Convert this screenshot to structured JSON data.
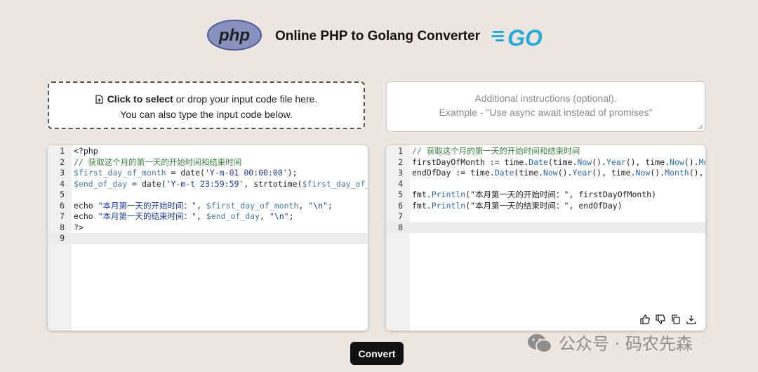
{
  "header": {
    "title": "Online PHP to Golang Converter",
    "php_logo_text": "php",
    "go_logo_text": "GO"
  },
  "dropzone": {
    "bold": "Click to select",
    "rest": " or drop your input code file here.",
    "line2": "You can also type the input code below."
  },
  "instructions": {
    "line1": "Additional instructions (optional).",
    "line2": "Example - \"Use async await instead of promises\""
  },
  "php_editor": {
    "lines": [
      [
        {
          "t": "<?php",
          "c": "plain"
        }
      ],
      [
        {
          "t": "// 获取这个月的第一天的开始时间和结束时间",
          "c": "comment"
        }
      ],
      [
        {
          "t": "$first_day_of_month",
          "c": "var"
        },
        {
          "t": " = ",
          "c": "plain"
        },
        {
          "t": "date(",
          "c": "plain"
        },
        {
          "t": "'Y-m-01 00:00:00'",
          "c": "str"
        },
        {
          "t": ");",
          "c": "plain"
        }
      ],
      [
        {
          "t": "$end_of_day",
          "c": "var"
        },
        {
          "t": " = date(",
          "c": "plain"
        },
        {
          "t": "'Y-m-t 23:59:59'",
          "c": "str"
        },
        {
          "t": ", strtotime(",
          "c": "plain"
        },
        {
          "t": "$first_day_of_month",
          "c": "var"
        },
        {
          "t": "));",
          "c": "plain"
        }
      ],
      [
        {
          "t": "",
          "c": "plain"
        }
      ],
      [
        {
          "t": "echo ",
          "c": "plain"
        },
        {
          "t": "\"本月第一天的开始时间：\"",
          "c": "str"
        },
        {
          "t": ", ",
          "c": "plain"
        },
        {
          "t": "$first_day_of_month",
          "c": "var"
        },
        {
          "t": ", ",
          "c": "plain"
        },
        {
          "t": "\"\\n\"",
          "c": "str"
        },
        {
          "t": ";",
          "c": "plain"
        }
      ],
      [
        {
          "t": "echo ",
          "c": "plain"
        },
        {
          "t": "\"本月第一天的结束时间：\"",
          "c": "str"
        },
        {
          "t": ", ",
          "c": "plain"
        },
        {
          "t": "$end_of_day",
          "c": "var"
        },
        {
          "t": ", ",
          "c": "plain"
        },
        {
          "t": "\"\\n\"",
          "c": "str"
        },
        {
          "t": ";",
          "c": "plain"
        }
      ],
      [
        {
          "t": "?>",
          "c": "plain"
        }
      ],
      [
        {
          "t": "",
          "c": "plain"
        }
      ]
    ],
    "active_line": 9
  },
  "go_editor": {
    "lines": [
      [
        {
          "t": "// 获取这个月的第一天的开始时间和结束时间",
          "c": "comment"
        }
      ],
      [
        {
          "t": "firstDayOfMonth := time.",
          "c": "plain"
        },
        {
          "t": "Date",
          "c": "fn"
        },
        {
          "t": "(time.",
          "c": "plain"
        },
        {
          "t": "Now",
          "c": "fn"
        },
        {
          "t": "().",
          "c": "plain"
        },
        {
          "t": "Year",
          "c": "fn"
        },
        {
          "t": "(), time.",
          "c": "plain"
        },
        {
          "t": "Now",
          "c": "fn"
        },
        {
          "t": "().",
          "c": "plain"
        },
        {
          "t": "Month",
          "c": "fn"
        },
        {
          "t": "(), 1, 0, 0, 0, 0, time.Local)",
          "c": "plain"
        }
      ],
      [
        {
          "t": "endOfDay := time.",
          "c": "plain"
        },
        {
          "t": "Date",
          "c": "fn"
        },
        {
          "t": "(time.",
          "c": "plain"
        },
        {
          "t": "Now",
          "c": "fn"
        },
        {
          "t": "().",
          "c": "plain"
        },
        {
          "t": "Year",
          "c": "fn"
        },
        {
          "t": "(), time.",
          "c": "plain"
        },
        {
          "t": "Now",
          "c": "fn"
        },
        {
          "t": "().",
          "c": "plain"
        },
        {
          "t": "Month",
          "c": "fn"
        },
        {
          "t": "(), 1, 23, 59, 59, 0, time.Local)",
          "c": "plain"
        }
      ],
      [
        {
          "t": "",
          "c": "plain"
        }
      ],
      [
        {
          "t": "fmt.",
          "c": "plain"
        },
        {
          "t": "Println",
          "c": "fn"
        },
        {
          "t": "(",
          "c": "plain"
        },
        {
          "t": "\"本月第一天的开始时间：\"",
          "c": "plain"
        },
        {
          "t": ", firstDayOfMonth)",
          "c": "plain"
        }
      ],
      [
        {
          "t": "fmt.",
          "c": "plain"
        },
        {
          "t": "Println",
          "c": "fn"
        },
        {
          "t": "(",
          "c": "plain"
        },
        {
          "t": "\"本月第一天的结束时间：\"",
          "c": "plain"
        },
        {
          "t": ", endOfDay)",
          "c": "plain"
        }
      ],
      [
        {
          "t": "",
          "c": "plain"
        }
      ],
      [
        {
          "t": "",
          "c": "plain"
        }
      ]
    ],
    "active_line": 8
  },
  "actions": [
    "thumbs-up-icon",
    "thumbs-down-icon",
    "copy-icon",
    "download-icon"
  ],
  "convert_label": "Convert",
  "watermark": "公众号 · 码农先森",
  "colors": {
    "background": "#ebe6e1",
    "php_purple": "#8892bf",
    "go_blue": "#29a9d6",
    "button": "#111111"
  }
}
